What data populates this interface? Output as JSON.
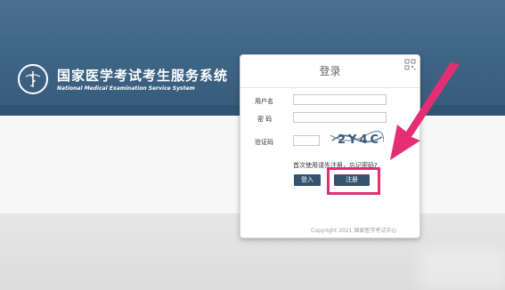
{
  "header": {
    "title_cn": "国家医学考试考生服务系统",
    "title_en": "National Medical Examination Service System"
  },
  "login": {
    "title": "登录",
    "username_label": "用户名",
    "password_label": "密 码",
    "captcha_label": "验证码",
    "captcha_text": "2Y4C",
    "first_use_text": "首次使用请先注册，忘记密码?",
    "login_button": "登入",
    "register_button": "注册",
    "copyright": "Copyright 2021 国家医学考试中心"
  },
  "colors": {
    "header_bg": "#3e6484",
    "button_bg": "#33536f",
    "highlight": "#e32e74"
  }
}
